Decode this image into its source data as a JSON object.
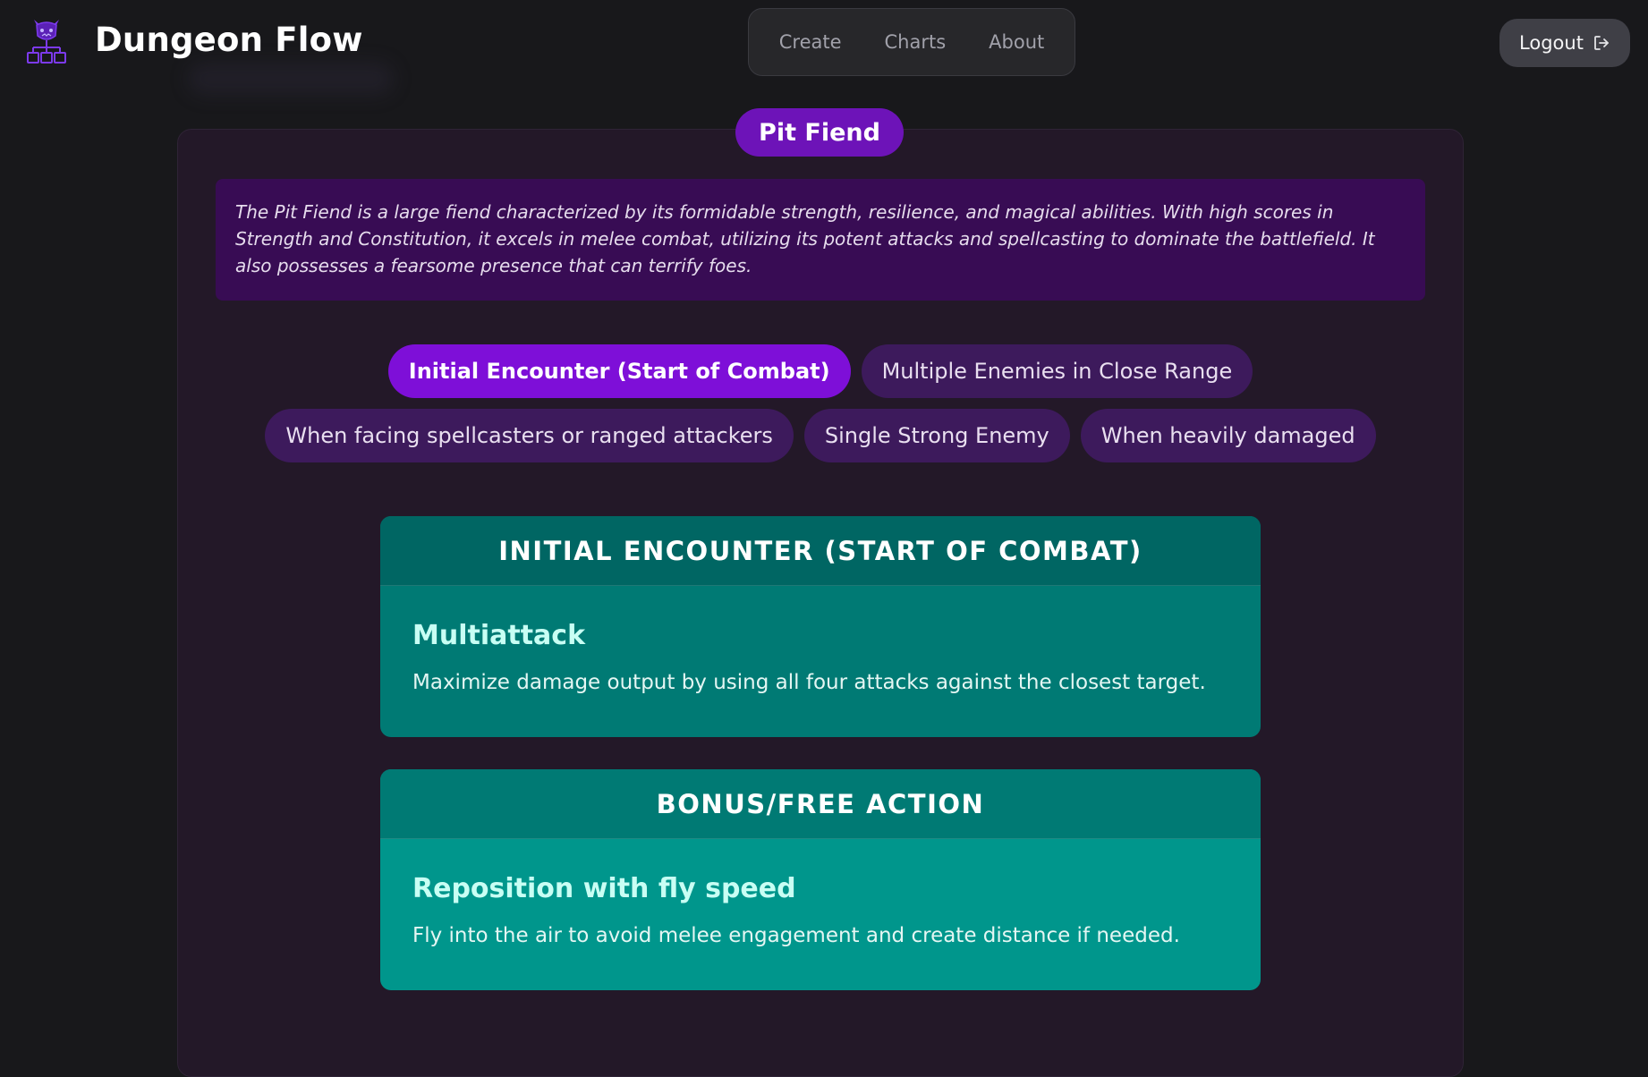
{
  "app": {
    "title": "Dungeon Flow",
    "logo_icon": "demon-flowchart-icon"
  },
  "nav": {
    "items": [
      {
        "label": "Create"
      },
      {
        "label": "Charts"
      },
      {
        "label": "About"
      }
    ]
  },
  "user": {
    "logout_label": "Logout",
    "logout_icon": "logout-icon"
  },
  "monster": {
    "name": "Pit Fiend",
    "description": "The Pit Fiend is a large fiend characterized by its formidable strength, resilience, and magical abilities. With high scores in Strength and Constitution, it excels in melee combat, utilizing its potent attacks and spellcasting to dominate the battlefield. It also possesses a fearsome presence that can terrify foes."
  },
  "scenarios": {
    "row1": [
      {
        "label": "Initial Encounter (Start of Combat)",
        "active": true
      },
      {
        "label": "Multiple Enemies in Close Range",
        "active": false
      }
    ],
    "row2": [
      {
        "label": "When facing spellcasters or ranged attackers",
        "active": false
      },
      {
        "label": "Single Strong Enemy",
        "active": false
      },
      {
        "label": "When heavily damaged",
        "active": false
      }
    ]
  },
  "cards": [
    {
      "header": "INITIAL ENCOUNTER (START OF COMBAT)",
      "title": "Multiattack",
      "text": "Maximize damage output by using all four attacks against the closest target."
    },
    {
      "header": "BONUS/FREE ACTION",
      "title": "Reposition with fly speed",
      "text": "Fly into the air to avoid melee engagement and create distance if needed."
    }
  ],
  "colors": {
    "background": "#18181b",
    "accent_purple": "#7e0fd8",
    "teal_card": "#007a74",
    "teal_card_light": "#00968c"
  }
}
